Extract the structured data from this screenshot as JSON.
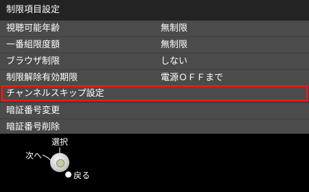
{
  "title": "制限項目設定",
  "menu": [
    {
      "label": "視聴可能年齢",
      "value": "無制限"
    },
    {
      "label": "一番組限度額",
      "value": "無制限"
    },
    {
      "label": "ブラウザ制限",
      "value": "しない"
    },
    {
      "label": "制限解除有効期限",
      "value": "電源ＯＦＦまで"
    },
    {
      "label": "チャンネルスキップ設定",
      "value": ""
    },
    {
      "label": "暗証番号変更",
      "value": ""
    },
    {
      "label": "暗証番号削除",
      "value": ""
    }
  ],
  "help": {
    "select": "選択",
    "next": "次へ",
    "back": "戻る"
  },
  "colors": {
    "highlight": "#e41a1a"
  }
}
